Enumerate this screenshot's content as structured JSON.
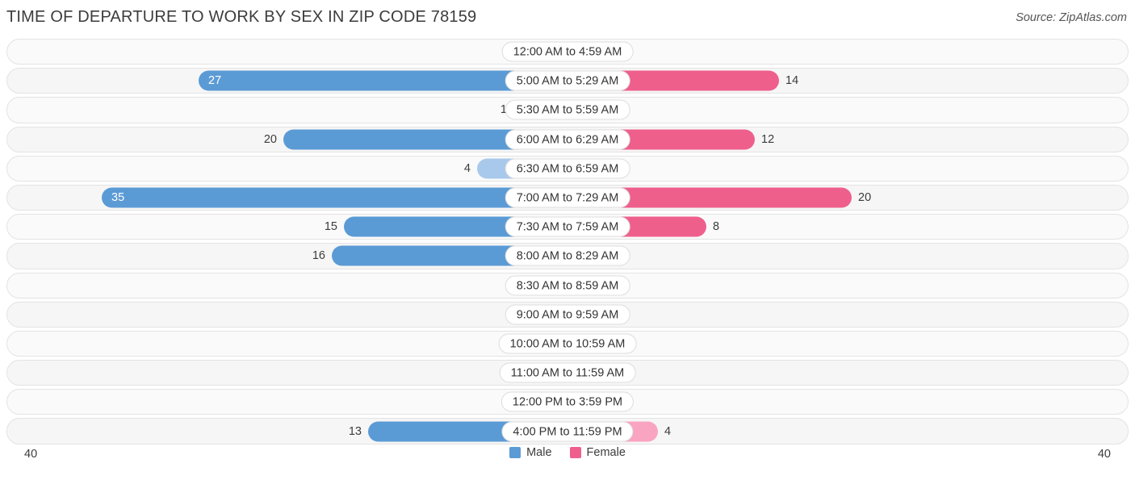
{
  "header": {
    "title": "TIME OF DEPARTURE TO WORK BY SEX IN ZIP CODE 78159",
    "source": "Source: ZipAtlas.com"
  },
  "legend": {
    "male_label": "Male",
    "female_label": "Female",
    "male_color": "#5b9bd5",
    "female_color": "#ef5f8c"
  },
  "axis": {
    "left_max": "40",
    "right_max": "40"
  },
  "chart_data": {
    "type": "bar",
    "title": "TIME OF DEPARTURE TO WORK BY SEX IN ZIP CODE 78159",
    "orientation": "horizontal-diverging",
    "xlabel": "",
    "ylabel": "",
    "xlim": [
      40,
      40
    ],
    "grid": false,
    "legend_position": "bottom",
    "categories": [
      "12:00 AM to 4:59 AM",
      "5:00 AM to 5:29 AM",
      "5:30 AM to 5:59 AM",
      "6:00 AM to 6:29 AM",
      "6:30 AM to 6:59 AM",
      "7:00 AM to 7:29 AM",
      "7:30 AM to 7:59 AM",
      "8:00 AM to 8:29 AM",
      "8:30 AM to 8:59 AM",
      "9:00 AM to 9:59 AM",
      "10:00 AM to 10:59 AM",
      "11:00 AM to 11:59 AM",
      "12:00 PM to 3:59 PM",
      "4:00 PM to 11:59 PM"
    ],
    "series": [
      {
        "name": "Male",
        "values": [
          0,
          27,
          1,
          20,
          4,
          35,
          15,
          16,
          0,
          0,
          0,
          0,
          0,
          13
        ]
      },
      {
        "name": "Female",
        "values": [
          0,
          14,
          0,
          12,
          0,
          20,
          8,
          0,
          0,
          0,
          0,
          0,
          0,
          4
        ]
      }
    ]
  }
}
